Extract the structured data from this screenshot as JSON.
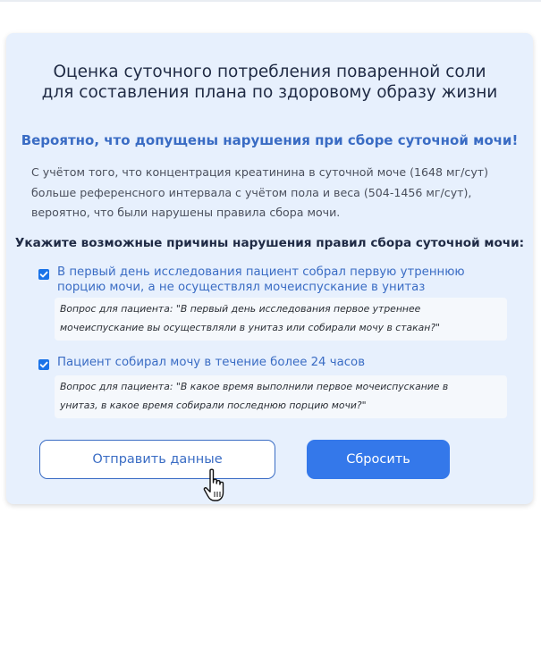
{
  "card": {
    "title_line1": "Оценка суточного потребления поваренной соли",
    "title_line2": "для составления плана по здоровому образу жизни",
    "subtitle": "Вероятно, что допущены нарушения при сборе суточной мочи!",
    "description_line1": "С учётом того, что концентрация креатинина в суточной моче (1648 мг/сут)",
    "description_line2": "больше референсного интервала с учётом пола и веса (504-1456 мг/сут),",
    "description_line3": "вероятно, что были нарушены правила сбора мочи.",
    "question": "Укажите возможные причины нарушения правил сбора суточной мочи:",
    "reasons": [
      {
        "checked": true,
        "label_line1": "В первый день исследования пациент собрал первую утреннюю",
        "label_line2": "порцию мочи, а не осуществлял мочеиспускание в унитаз",
        "note_line1": "Вопрос для пациента: \"В первый день исследования первое утреннее",
        "note_line2": "мочеиспускание вы осуществляли в унитаз или собирали мочу в стакан?\""
      },
      {
        "checked": true,
        "label_line1": "Пациент собирал мочу в течение более 24 часов",
        "note_line1": "Вопрос для пациента: \"В какое время выполнили первое мочеиспускание в",
        "note_line2": "унитаз, в какое время собирали последнюю порцию мочи?\""
      }
    ],
    "buttons": {
      "submit_label": "Отправить данные",
      "reset_label": "Сбросить"
    }
  },
  "colors": {
    "card_background": "#e7f0fd",
    "accent_blue": "#3a6cc4",
    "button_primary": "#3478ea",
    "checkbox": "#1a73e8"
  },
  "icons": {
    "checkbox": "checkmark-icon",
    "pointer": "hand-pointer-icon"
  }
}
